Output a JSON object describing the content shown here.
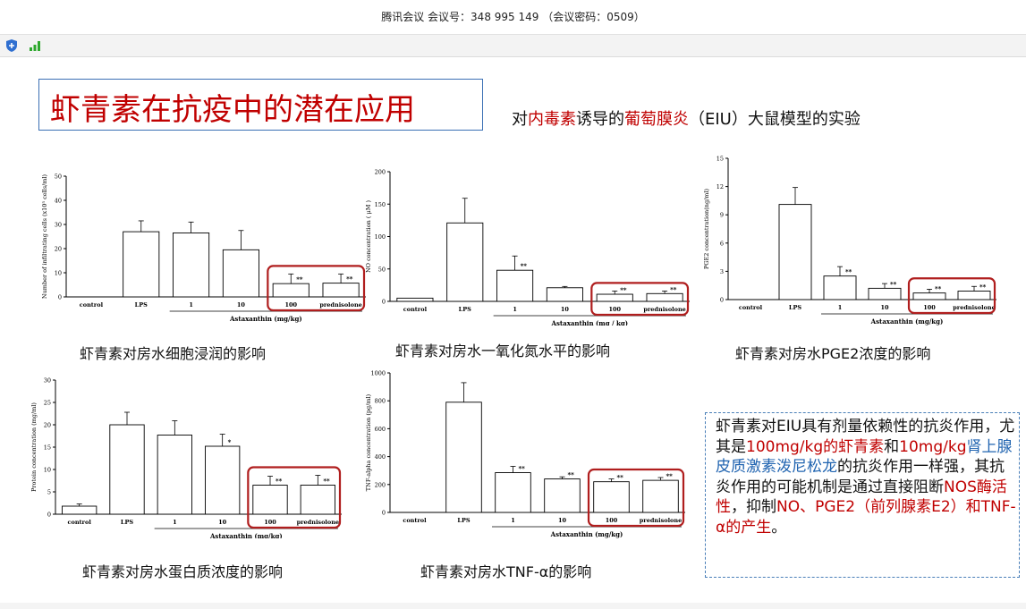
{
  "meeting_bar": {
    "text": "腾讯会议 会议号：348 995 149 （会议密码：0509）"
  },
  "toolbar": {
    "shield_icon": "shield-icon",
    "signal_icon": "signal-bars-icon"
  },
  "slide": {
    "title": "虾青素在抗疫中的潜在应用",
    "subtitle": {
      "pre": "对",
      "red1": "内毒素",
      "mid": "诱导的",
      "red2": "葡萄膜炎",
      "post": "（EIU）大鼠模型的实验"
    },
    "captions": [
      "虾青素对房水细胞浸润的影响",
      "虾青素对房水一氧化氮水平的影响",
      "虾青素对房水PGE2浓度的影响",
      "虾青素对房水蛋白质浓度的影响",
      "虾青素对房水TNF-α的影响"
    ],
    "note": {
      "p1": "虾青素对EIU具有剂量依赖性的抗炎作用，尤其是",
      "r1": "100mg/kg的虾青素",
      "p2": "和",
      "r2": "10mg/kg",
      "b1": "肾上腺皮质激素泼尼松龙",
      "p3": "的抗炎作用一样强，其抗炎作用的可能机制是通过直接阻断",
      "r3": "NOS酶活性",
      "p4": "，抑制",
      "r4": "NO、PGE2（前列腺素E2）和TNF-α的产生",
      "p5": "。"
    }
  },
  "colors": {
    "title_red": "#c00000",
    "note_blue": "#1f63b0",
    "highlight_box": "#b01e1e"
  },
  "chart_data": [
    {
      "type": "bar",
      "categories": [
        "control",
        "LPS",
        "1",
        "10",
        "100",
        "prednisolone"
      ],
      "values": [
        0,
        27,
        26.5,
        19.5,
        5.5,
        5.7
      ],
      "errors": [
        0,
        4.5,
        4.5,
        8,
        4,
        3.8
      ],
      "sig": [
        "",
        "",
        "",
        "",
        "**",
        "**"
      ],
      "ylim": [
        0,
        50
      ],
      "yticks": [
        0,
        10,
        20,
        30,
        40,
        50
      ],
      "ylabel": "Number of infiltrating cells (x10⁵ cells/ml)",
      "xlabel": "Astaxanthin (mg/kg)",
      "highlight": [
        4,
        5
      ]
    },
    {
      "type": "bar",
      "categories": [
        "control",
        "LPS",
        "1",
        "10",
        "100",
        "prednisolone"
      ],
      "values": [
        5,
        121,
        48,
        21,
        11,
        12
      ],
      "errors": [
        0,
        38,
        22,
        2,
        5,
        4
      ],
      "sig": [
        "",
        "",
        "**",
        "",
        "**",
        "**"
      ],
      "ylim": [
        0,
        200
      ],
      "yticks": [
        0,
        50,
        100,
        150,
        200
      ],
      "ylabel": "NO concentration ( μM )",
      "xlabel": "Astaxanthin (mg / kg)",
      "highlight": [
        4,
        5
      ]
    },
    {
      "type": "bar",
      "categories": [
        "control",
        "LPS",
        "1",
        "10",
        "100",
        "prednisolone"
      ],
      "values": [
        0,
        10.1,
        2.5,
        1.2,
        0.7,
        0.9
      ],
      "errors": [
        0,
        1.8,
        1.0,
        0.5,
        0.4,
        0.5
      ],
      "sig": [
        "",
        "",
        "**",
        "**",
        "**",
        "**"
      ],
      "ylim": [
        0,
        15
      ],
      "yticks": [
        0,
        3,
        6,
        9,
        12,
        15
      ],
      "ylabel": "PGE2 concentration(ng/ml)",
      "xlabel": "Astaxanthin (mg/kg)",
      "highlight": [
        4,
        5
      ]
    },
    {
      "type": "bar",
      "categories": [
        "control",
        "LPS",
        "1",
        "10",
        "100",
        "prednisolone"
      ],
      "values": [
        1.8,
        20,
        17.7,
        15.2,
        6.5,
        6.5
      ],
      "errors": [
        0.5,
        2.8,
        3.2,
        2.7,
        2,
        2.2
      ],
      "sig": [
        "",
        "",
        "",
        "*",
        "**",
        "**"
      ],
      "ylim": [
        0,
        30
      ],
      "yticks": [
        0,
        5,
        10,
        15,
        20,
        25,
        30
      ],
      "ylabel": "Protein concentration (mg/ml)",
      "xlabel": "Astaxanthin (mg/kg)",
      "highlight": [
        4,
        5
      ]
    },
    {
      "type": "bar",
      "categories": [
        "control",
        "LPS",
        "1",
        "10",
        "100",
        "prednisolone"
      ],
      "values": [
        0,
        790,
        285,
        240,
        220,
        230
      ],
      "errors": [
        0,
        140,
        45,
        15,
        20,
        20
      ],
      "sig": [
        "",
        "",
        "**",
        "**",
        "**",
        "**"
      ],
      "ylim": [
        0,
        1000
      ],
      "yticks": [
        0,
        200,
        400,
        600,
        800,
        1000
      ],
      "ylabel": "TNF-alpha concentration (pg/ml)",
      "xlabel": "Astaxanthin (mg/kg)",
      "highlight": [
        4,
        5
      ]
    }
  ]
}
